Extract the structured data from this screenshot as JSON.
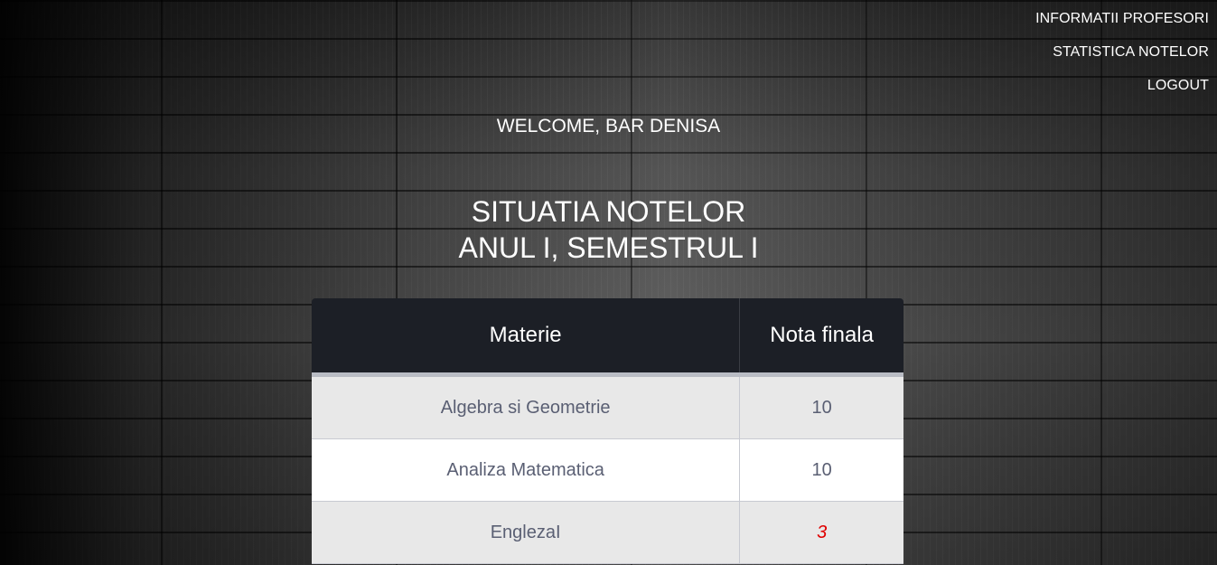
{
  "nav": {
    "items": [
      {
        "label": "INFORMATII PROFESORI"
      },
      {
        "label": "STATISTICA NOTELOR"
      },
      {
        "label": "LOGOUT"
      }
    ]
  },
  "welcome": "WELCOME, BAR DENISA",
  "heading": {
    "line1": "SITUATIA NOTELOR",
    "line2": "ANUL I, SEMESTRUL I"
  },
  "table": {
    "headers": {
      "subject": "Materie",
      "grade": "Nota finala"
    },
    "rows": [
      {
        "subject": "Algebra si Geometrie",
        "grade": "10"
      },
      {
        "subject": "Analiza Matematica",
        "grade": "10"
      },
      {
        "subject": "EnglezaI",
        "grade": "3"
      }
    ]
  },
  "colors": {
    "table_header_bg": "#1c1f26",
    "failing_grade": "#e00000",
    "cell_text": "#5a5f73"
  }
}
